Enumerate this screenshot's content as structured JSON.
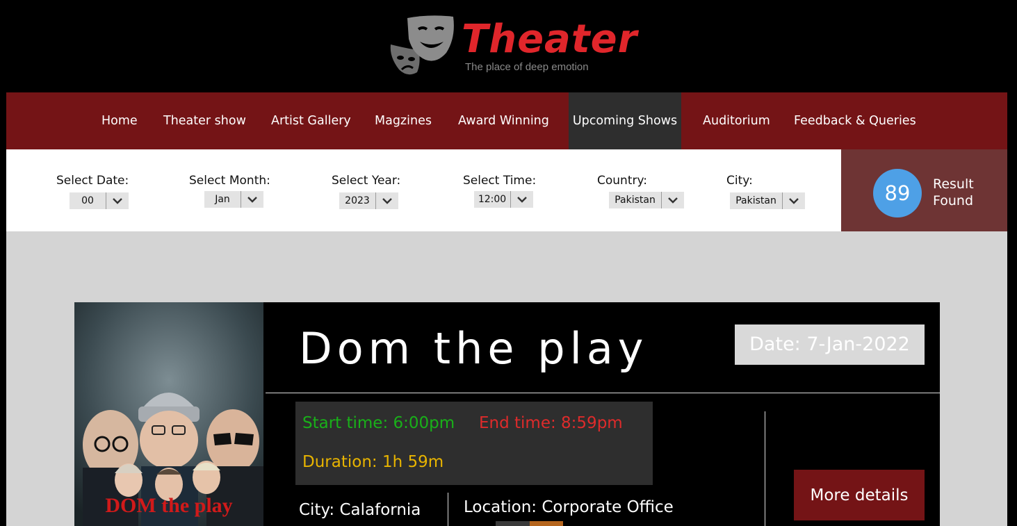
{
  "header": {
    "title": "Theater",
    "tagline": "The place of deep emotion",
    "logo_icon": "theater-masks-icon"
  },
  "nav": {
    "items": [
      {
        "label": "Home"
      },
      {
        "label": "Theater show"
      },
      {
        "label": "Artist Gallery"
      },
      {
        "label": "Magzines"
      },
      {
        "label": "Award Winning"
      },
      {
        "label": "Upcoming Shows",
        "active": true
      },
      {
        "label": "Auditorium"
      },
      {
        "label": "Feedback & Queries"
      }
    ]
  },
  "filters": {
    "date": {
      "label": "Select Date:",
      "value": "00"
    },
    "month": {
      "label": "Select Month:",
      "value": "Jan"
    },
    "year": {
      "label": "Select Year:",
      "value": "2023"
    },
    "time": {
      "label": "Select Time:",
      "value": "12:00"
    },
    "country": {
      "label": "Country:",
      "value": "Pakistan"
    },
    "city": {
      "label": "City:",
      "value": "Pakistan"
    }
  },
  "results": {
    "count": "89",
    "line1": "Result",
    "line2": "Found"
  },
  "show": {
    "title": "Dom the play",
    "poster_caption": "DOM the play",
    "date": "Date: 7-Jan-2022",
    "start_time": "Start time: 6:00pm",
    "end_time": "End time: 8:59pm",
    "duration": "Duration: 1h 59m",
    "city": "City: Calafornia",
    "location": "Location: Corporate Office",
    "more_label": "More details"
  },
  "colors": {
    "nav_bg": "#741416",
    "nav_active": "#2e2e2e",
    "brand_red": "#e0262b",
    "result_bg": "#6e3434",
    "result_circle": "#4ea0e6",
    "start_green": "#19b019",
    "end_red": "#de2b2b",
    "duration_yellow": "#e8b400"
  }
}
